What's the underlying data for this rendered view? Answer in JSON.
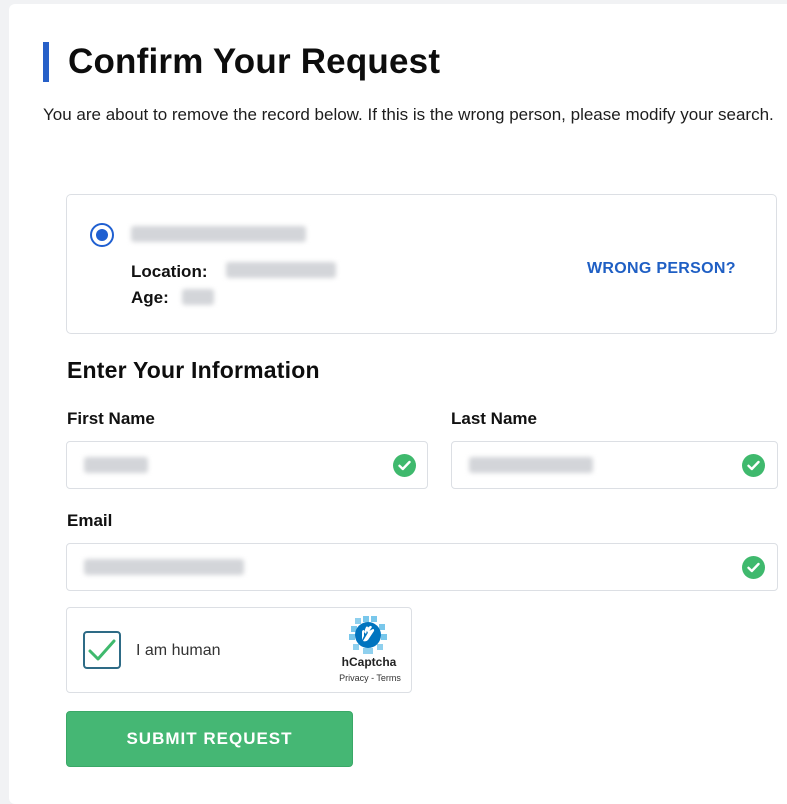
{
  "page": {
    "title": "Confirm Your Request",
    "intro": "You are about to remove the record below. If this is the wrong person, please modify your search."
  },
  "record": {
    "location_label": "Location:",
    "age_label": "Age:",
    "wrong_person_link": "WRONG PERSON?"
  },
  "form": {
    "heading": "Enter Your Information",
    "first_name_label": "First Name",
    "last_name_label": "Last Name",
    "email_label": "Email"
  },
  "captcha": {
    "label": "I am human",
    "brand": "hCaptcha",
    "links": "Privacy - Terms"
  },
  "submit": {
    "label": "SUBMIT REQUEST"
  },
  "colors": {
    "accent_blue": "#1f5fd1",
    "success_green": "#3fb96d",
    "submit_green": "#45b774"
  }
}
